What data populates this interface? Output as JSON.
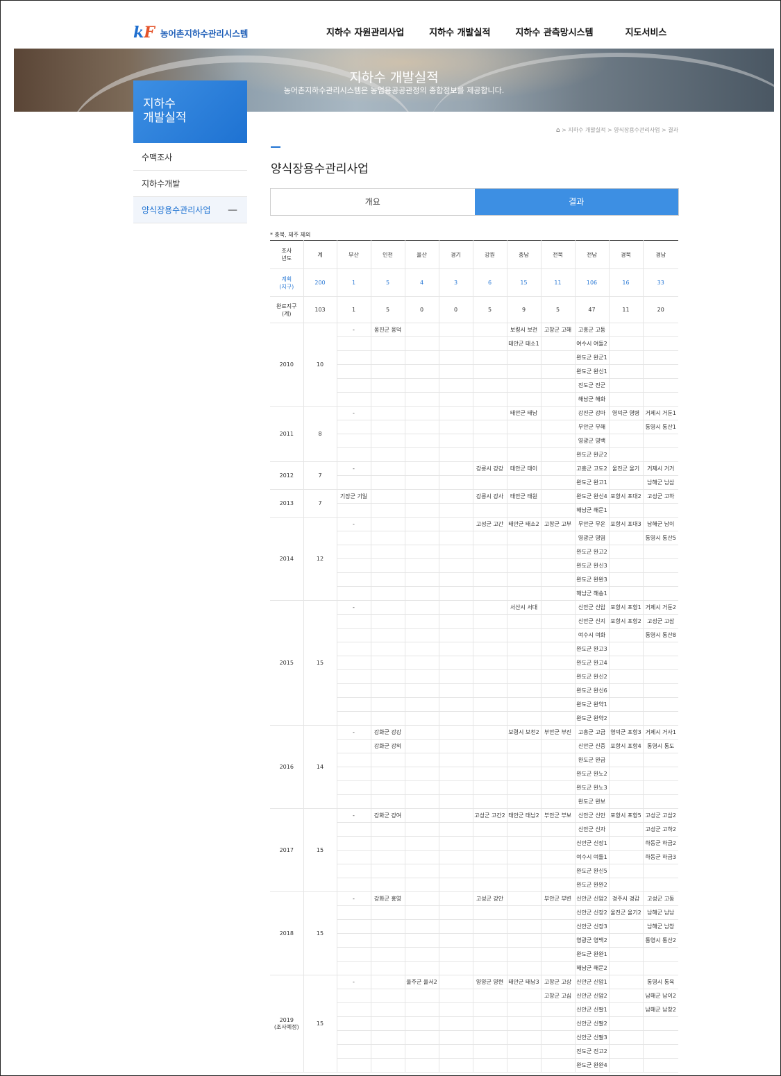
{
  "header": {
    "logo_mark_k": "k",
    "logo_mark_f": "F",
    "logo_text": "농어촌지하수관리시스템",
    "menu": [
      "지하수 자원관리사업",
      "지하수 개발실적",
      "지하수 관측망시스템",
      "지도서비스"
    ]
  },
  "banner": {
    "title": "지하수 개발실적",
    "subtitle": "농어촌지하수관리시스템은 농업용공공관정의 종합정보를 제공합니다."
  },
  "sidebar": {
    "title": "지하수 개발실적",
    "items": [
      {
        "label": "수맥조사"
      },
      {
        "label": "지하수개발"
      },
      {
        "label": "양식장용수관리사업"
      }
    ],
    "active_marker": "—"
  },
  "breadcrumb": {
    "home_icon": "⌂",
    "path": "> 지하수 개발실적 > 양식장용수관리사업 > 결과"
  },
  "page": {
    "title": "양식장용수관리사업",
    "tabs": [
      "개요",
      "결과"
    ],
    "active_tab": 1,
    "note": "* 충북, 제주 제외"
  },
  "table": {
    "headers": [
      "조사\n년도",
      "계",
      "부산",
      "인천",
      "울산",
      "경기",
      "강원",
      "충남",
      "전북",
      "전남",
      "경북",
      "경남"
    ],
    "plan_label": "계획\n(지구)",
    "plan": [
      "200",
      "1",
      "5",
      "4",
      "3",
      "6",
      "15",
      "11",
      "106",
      "16",
      "33"
    ],
    "done_label": "완료지구\n(계)",
    "done": [
      "103",
      "1",
      "5",
      "0",
      "0",
      "5",
      "9",
      "5",
      "47",
      "11",
      "20"
    ],
    "years": [
      {
        "year": "2010",
        "total": "10",
        "rows": [
          [
            "-",
            "옹진군 옹덕",
            "",
            "",
            "",
            "보령시 보천",
            "고창군 고해",
            "고흥군 고동",
            "",
            ""
          ],
          [
            "",
            "",
            "",
            "",
            "",
            "태안군 태소1",
            "",
            "여수시 여돌2",
            "",
            ""
          ],
          [
            "",
            "",
            "",
            "",
            "",
            "",
            "",
            "완도군 완군1",
            "",
            ""
          ],
          [
            "",
            "",
            "",
            "",
            "",
            "",
            "",
            "완도군 완신1",
            "",
            ""
          ],
          [
            "",
            "",
            "",
            "",
            "",
            "",
            "",
            "진도군 진군",
            "",
            ""
          ],
          [
            "",
            "",
            "",
            "",
            "",
            "",
            "",
            "해남군 해화",
            "",
            ""
          ]
        ]
      },
      {
        "year": "2011",
        "total": "8",
        "rows": [
          [
            "-",
            "",
            "",
            "",
            "",
            "태안군 태남",
            "",
            "강진군 강마",
            "영덕군 영병",
            "거제시 거둔1"
          ],
          [
            "",
            "",
            "",
            "",
            "",
            "",
            "",
            "무안군 무해",
            "",
            "통영시 통산1"
          ],
          [
            "",
            "",
            "",
            "",
            "",
            "",
            "",
            "영광군 영백",
            "",
            ""
          ],
          [
            "",
            "",
            "",
            "",
            "",
            "",
            "",
            "완도군 완군2",
            "",
            ""
          ]
        ]
      },
      {
        "year": "2012",
        "total": "7",
        "rows": [
          [
            "-",
            "",
            "",
            "",
            "강릉시 강강",
            "태안군 태이",
            "",
            "고흥군 고도2",
            "울진군 울기",
            "거제시 거거"
          ],
          [
            "",
            "",
            "",
            "",
            "",
            "",
            "",
            "완도군 완고1",
            "",
            "남해군 남삼"
          ]
        ]
      },
      {
        "year": "2013",
        "total": "7",
        "rows": [
          [
            "기장군 기일",
            "",
            "",
            "",
            "강릉시 강사",
            "태안군 태원",
            "",
            "완도군 완신4",
            "포항시 포대2",
            "고성군 고하"
          ],
          [
            "",
            "",
            "",
            "",
            "",
            "",
            "",
            "해남군 해문1",
            "",
            ""
          ]
        ]
      },
      {
        "year": "2014",
        "total": "12",
        "rows": [
          [
            "-",
            "",
            "",
            "",
            "고성군 고간",
            "태안군 태소2",
            "고창군 고부",
            "무안군 무운",
            "포항시 포대3",
            "남해군 남이"
          ],
          [
            "",
            "",
            "",
            "",
            "",
            "",
            "",
            "영광군 영염",
            "",
            "통영시 통산5"
          ],
          [
            "",
            "",
            "",
            "",
            "",
            "",
            "",
            "완도군 완고2",
            "",
            ""
          ],
          [
            "",
            "",
            "",
            "",
            "",
            "",
            "",
            "완도군 완신3",
            "",
            ""
          ],
          [
            "",
            "",
            "",
            "",
            "",
            "",
            "",
            "완도군 완완3",
            "",
            ""
          ],
          [
            "",
            "",
            "",
            "",
            "",
            "",
            "",
            "해남군 해송1",
            "",
            ""
          ]
        ]
      },
      {
        "year": "2015",
        "total": "15",
        "rows": [
          [
            "-",
            "",
            "",
            "",
            "",
            "서산시 서대",
            "",
            "신안군 신압",
            "포항시 포항1",
            "거제시 거둔2"
          ],
          [
            "",
            "",
            "",
            "",
            "",
            "",
            "",
            "신안군 신지",
            "포항시 포항2",
            "고성군 고삼"
          ],
          [
            "",
            "",
            "",
            "",
            "",
            "",
            "",
            "여수시 여화",
            "",
            "통영시 통산8"
          ],
          [
            "",
            "",
            "",
            "",
            "",
            "",
            "",
            "완도군 완고3",
            "",
            ""
          ],
          [
            "",
            "",
            "",
            "",
            "",
            "",
            "",
            "완도군 완고4",
            "",
            ""
          ],
          [
            "",
            "",
            "",
            "",
            "",
            "",
            "",
            "완도군 완신2",
            "",
            ""
          ],
          [
            "",
            "",
            "",
            "",
            "",
            "",
            "",
            "완도군 완신6",
            "",
            ""
          ],
          [
            "",
            "",
            "",
            "",
            "",
            "",
            "",
            "완도군 완약1",
            "",
            ""
          ],
          [
            "",
            "",
            "",
            "",
            "",
            "",
            "",
            "완도군 완약2",
            "",
            ""
          ]
        ]
      },
      {
        "year": "2016",
        "total": "14",
        "rows": [
          [
            "-",
            "강화군 강강",
            "",
            "",
            "",
            "보령시 보천2",
            "부안군 부진",
            "고흥군 고금",
            "영덕군 포항3",
            "거제시 거사1"
          ],
          [
            "",
            "강화군 강외",
            "",
            "",
            "",
            "",
            "",
            "신안군 신증",
            "포항시 포항4",
            "통영시 통도"
          ],
          [
            "",
            "",
            "",
            "",
            "",
            "",
            "",
            "완도군 완금",
            "",
            ""
          ],
          [
            "",
            "",
            "",
            "",
            "",
            "",
            "",
            "완도군 완노2",
            "",
            ""
          ],
          [
            "",
            "",
            "",
            "",
            "",
            "",
            "",
            "완도군 완노3",
            "",
            ""
          ],
          [
            "",
            "",
            "",
            "",
            "",
            "",
            "",
            "완도군 완보",
            "",
            ""
          ]
        ]
      },
      {
        "year": "2017",
        "total": "15",
        "rows": [
          [
            "-",
            "강화군 강여",
            "",
            "",
            "고성군 고간2",
            "태안군 태남2",
            "부안군 부보",
            "신안군 신안",
            "포항시 포항5",
            "고성군 고삼2"
          ],
          [
            "",
            "",
            "",
            "",
            "",
            "",
            "",
            "신안군 신자",
            "",
            "고성군 고하2"
          ],
          [
            "",
            "",
            "",
            "",
            "",
            "",
            "",
            "신안군 신장1",
            "",
            "하동군 하금2"
          ],
          [
            "",
            "",
            "",
            "",
            "",
            "",
            "",
            "여수시 여돌1",
            "",
            "하동군 하금3"
          ],
          [
            "",
            "",
            "",
            "",
            "",
            "",
            "",
            "완도군 완신5",
            "",
            ""
          ],
          [
            "",
            "",
            "",
            "",
            "",
            "",
            "",
            "완도군 완완2",
            "",
            ""
          ]
        ]
      },
      {
        "year": "2018",
        "total": "15",
        "rows": [
          [
            "-",
            "강화군 홍영",
            "",
            "",
            "고성군 강안",
            "",
            "부안군 부변",
            "신안군 신압2",
            "경주시 경감",
            "고성군 고동"
          ],
          [
            "",
            "",
            "",
            "",
            "",
            "",
            "",
            "신안군 신장2",
            "울진군 울기2",
            "남해군 남남"
          ],
          [
            "",
            "",
            "",
            "",
            "",
            "",
            "",
            "신안군 신장3",
            "",
            "남해군 남창"
          ],
          [
            "",
            "",
            "",
            "",
            "",
            "",
            "",
            "영광군 영백2",
            "",
            "통영시 통산2"
          ],
          [
            "",
            "",
            "",
            "",
            "",
            "",
            "",
            "완도군 완완1",
            "",
            ""
          ],
          [
            "",
            "",
            "",
            "",
            "",
            "",
            "",
            "해남군 해문2",
            "",
            ""
          ]
        ]
      },
      {
        "year": "2019\n(조사예정)",
        "total": "15",
        "rows": [
          [
            "-",
            "",
            "울주군 울서2",
            "",
            "양양군 양현",
            "태안군 태남3",
            "고창군 고상",
            "신안군 신압1",
            "",
            "통영시 통육"
          ],
          [
            "",
            "",
            "",
            "",
            "",
            "",
            "고창군 고심",
            "신안군 신압2",
            "",
            "남해군 남이2"
          ],
          [
            "",
            "",
            "",
            "",
            "",
            "",
            "",
            "신안군 신팔1",
            "",
            "남해군 남창2"
          ],
          [
            "",
            "",
            "",
            "",
            "",
            "",
            "",
            "신안군 신팔2",
            "",
            ""
          ],
          [
            "",
            "",
            "",
            "",
            "",
            "",
            "",
            "신안군 신팔3",
            "",
            ""
          ],
          [
            "",
            "",
            "",
            "",
            "",
            "",
            "",
            "진도군 진고2",
            "",
            ""
          ],
          [
            "",
            "",
            "",
            "",
            "",
            "",
            "",
            "완도군 완완4",
            "",
            ""
          ]
        ]
      }
    ]
  }
}
